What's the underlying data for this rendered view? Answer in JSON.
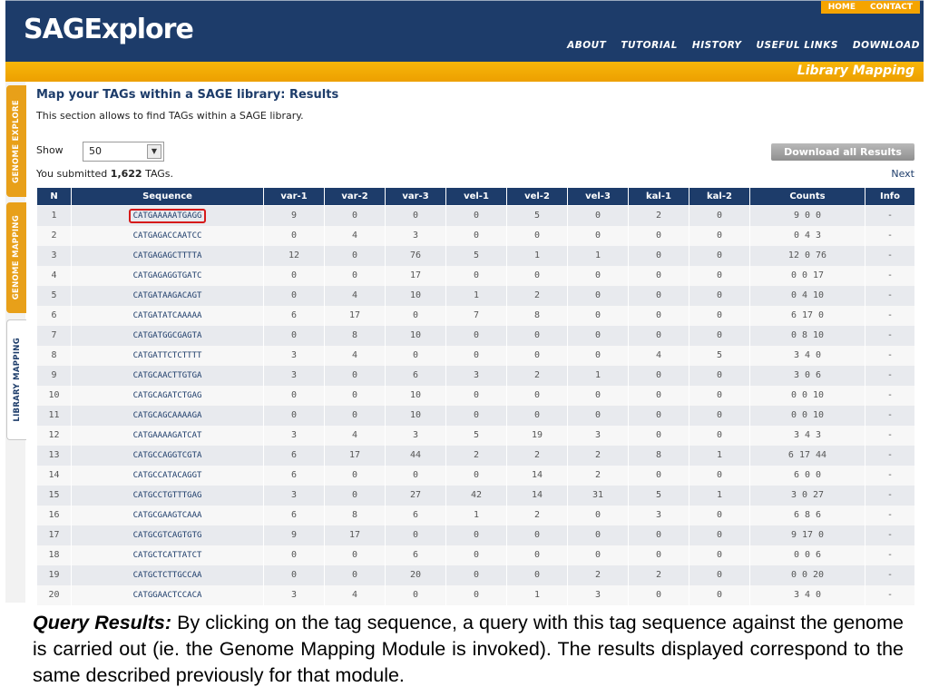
{
  "header": {
    "logo": "SAGExplore",
    "toplinks": [
      "HOME",
      "CONTACT"
    ],
    "nav": [
      "ABOUT",
      "TUTORIAL",
      "HISTORY",
      "USEFUL LINKS",
      "DOWNLOAD"
    ]
  },
  "section_title": "Library Mapping",
  "side_tabs": [
    "GENOME EXPLORE",
    "GENOME MAPPING",
    "LIBRARY MAPPING"
  ],
  "page": {
    "title": "Map your TAGs within a SAGE library: Results",
    "description": "This section allows to find TAGs within a SAGE library.",
    "show_label": "Show",
    "show_value": "50",
    "submitted_prefix": "You submitted ",
    "submitted_count": "1,622",
    "submitted_suffix": " TAGs.",
    "download_label": "Download all Results",
    "next_label": "Next"
  },
  "table": {
    "headers": [
      "N",
      "Sequence",
      "var-1",
      "var-2",
      "var-3",
      "vel-1",
      "vel-2",
      "vel-3",
      "kal-1",
      "kal-2",
      "Counts",
      "Info"
    ],
    "rows": [
      [
        "1",
        "CATGAAAAATGAGG",
        "9",
        "0",
        "0",
        "0",
        "5",
        "0",
        "2",
        "0",
        "9 0 0",
        "-"
      ],
      [
        "2",
        "CATGAGACCAATCC",
        "0",
        "4",
        "3",
        "0",
        "0",
        "0",
        "0",
        "0",
        "0 4 3",
        "-"
      ],
      [
        "3",
        "CATGAGAGCTTTTA",
        "12",
        "0",
        "76",
        "5",
        "1",
        "1",
        "0",
        "0",
        "12 0 76",
        "-"
      ],
      [
        "4",
        "CATGAGAGGTGATC",
        "0",
        "0",
        "17",
        "0",
        "0",
        "0",
        "0",
        "0",
        "0 0 17",
        "-"
      ],
      [
        "5",
        "CATGATAAGACAGT",
        "0",
        "4",
        "10",
        "1",
        "2",
        "0",
        "0",
        "0",
        "0 4 10",
        "-"
      ],
      [
        "6",
        "CATGATATCAAAAA",
        "6",
        "17",
        "0",
        "7",
        "8",
        "0",
        "0",
        "0",
        "6 17 0",
        "-"
      ],
      [
        "7",
        "CATGATGGCGAGTA",
        "0",
        "8",
        "10",
        "0",
        "0",
        "0",
        "0",
        "0",
        "0 8 10",
        "-"
      ],
      [
        "8",
        "CATGATTCTCTTTT",
        "3",
        "4",
        "0",
        "0",
        "0",
        "0",
        "4",
        "5",
        "3 4 0",
        "-"
      ],
      [
        "9",
        "CATGCAACTTGTGA",
        "3",
        "0",
        "6",
        "3",
        "2",
        "1",
        "0",
        "0",
        "3 0 6",
        "-"
      ],
      [
        "10",
        "CATGCAGATCTGAG",
        "0",
        "0",
        "10",
        "0",
        "0",
        "0",
        "0",
        "0",
        "0 0 10",
        "-"
      ],
      [
        "11",
        "CATGCAGCAAAAGA",
        "0",
        "0",
        "10",
        "0",
        "0",
        "0",
        "0",
        "0",
        "0 0 10",
        "-"
      ],
      [
        "12",
        "CATGAAAAGATCAT",
        "3",
        "4",
        "3",
        "5",
        "19",
        "3",
        "0",
        "0",
        "3 4 3",
        "-"
      ],
      [
        "13",
        "CATGCCAGGTCGTA",
        "6",
        "17",
        "44",
        "2",
        "2",
        "2",
        "8",
        "1",
        "6 17 44",
        "-"
      ],
      [
        "14",
        "CATGCCATACAGGT",
        "6",
        "0",
        "0",
        "0",
        "14",
        "2",
        "0",
        "0",
        "6 0 0",
        "-"
      ],
      [
        "15",
        "CATGCCTGTTTGAG",
        "3",
        "0",
        "27",
        "42",
        "14",
        "31",
        "5",
        "1",
        "3 0 27",
        "-"
      ],
      [
        "16",
        "CATGCGAAGTCAAA",
        "6",
        "8",
        "6",
        "1",
        "2",
        "0",
        "3",
        "0",
        "6 8 6",
        "-"
      ],
      [
        "17",
        "CATGCGTCAGTGTG",
        "9",
        "17",
        "0",
        "0",
        "0",
        "0",
        "0",
        "0",
        "9 17 0",
        "-"
      ],
      [
        "18",
        "CATGCTCATTATCT",
        "0",
        "0",
        "6",
        "0",
        "0",
        "0",
        "0",
        "0",
        "0 0 6",
        "-"
      ],
      [
        "19",
        "CATGCTCTTGCCAA",
        "0",
        "0",
        "20",
        "0",
        "0",
        "2",
        "2",
        "0",
        "0 0 20",
        "-"
      ],
      [
        "20",
        "CATGGAACTCCACA",
        "3",
        "4",
        "0",
        "0",
        "1",
        "3",
        "0",
        "0",
        "3 4 0",
        "-"
      ]
    ]
  },
  "caption": {
    "lead": "Query Results:",
    "text": " By clicking on the tag sequence, a query with this tag sequence against the genome is carried out (ie. the Genome Mapping Module is invoked). The results displayed correspond to the same described previously for that module."
  },
  "colors": {
    "navy": "#1d3c6a",
    "orange": "#f5a400",
    "highlight": "#d61a1a"
  }
}
